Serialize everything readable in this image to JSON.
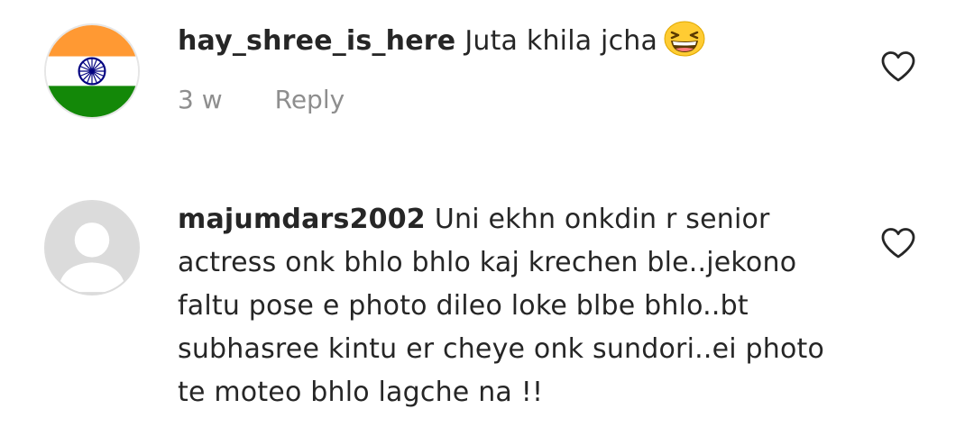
{
  "comments": [
    {
      "username": "hay_shree_is_here",
      "text": "Juta khila jcha",
      "emoji": "grinning-squinting-face-emoji",
      "time": "3 w",
      "reply_label": "Reply",
      "avatar": "india-flag-avatar",
      "like_icon": "heart-outline-icon"
    },
    {
      "username": "majumdars2002",
      "text": "Uni ekhn onkdin r senior actress onk bhlo bhlo kaj krechen ble..jekono faltu pose e photo dileo loke blbe bhlo..bt subhasree kintu er cheye onk sundori..ei photo te moteo bhlo lagche na !!",
      "avatar": "default-avatar",
      "like_icon": "heart-outline-icon"
    }
  ],
  "colors": {
    "text": "#262626",
    "secondary": "#8e8e8e",
    "saffron": "#ff9933",
    "green": "#138808",
    "chakra": "#000080",
    "avatar_grey": "#dbdbdb"
  }
}
